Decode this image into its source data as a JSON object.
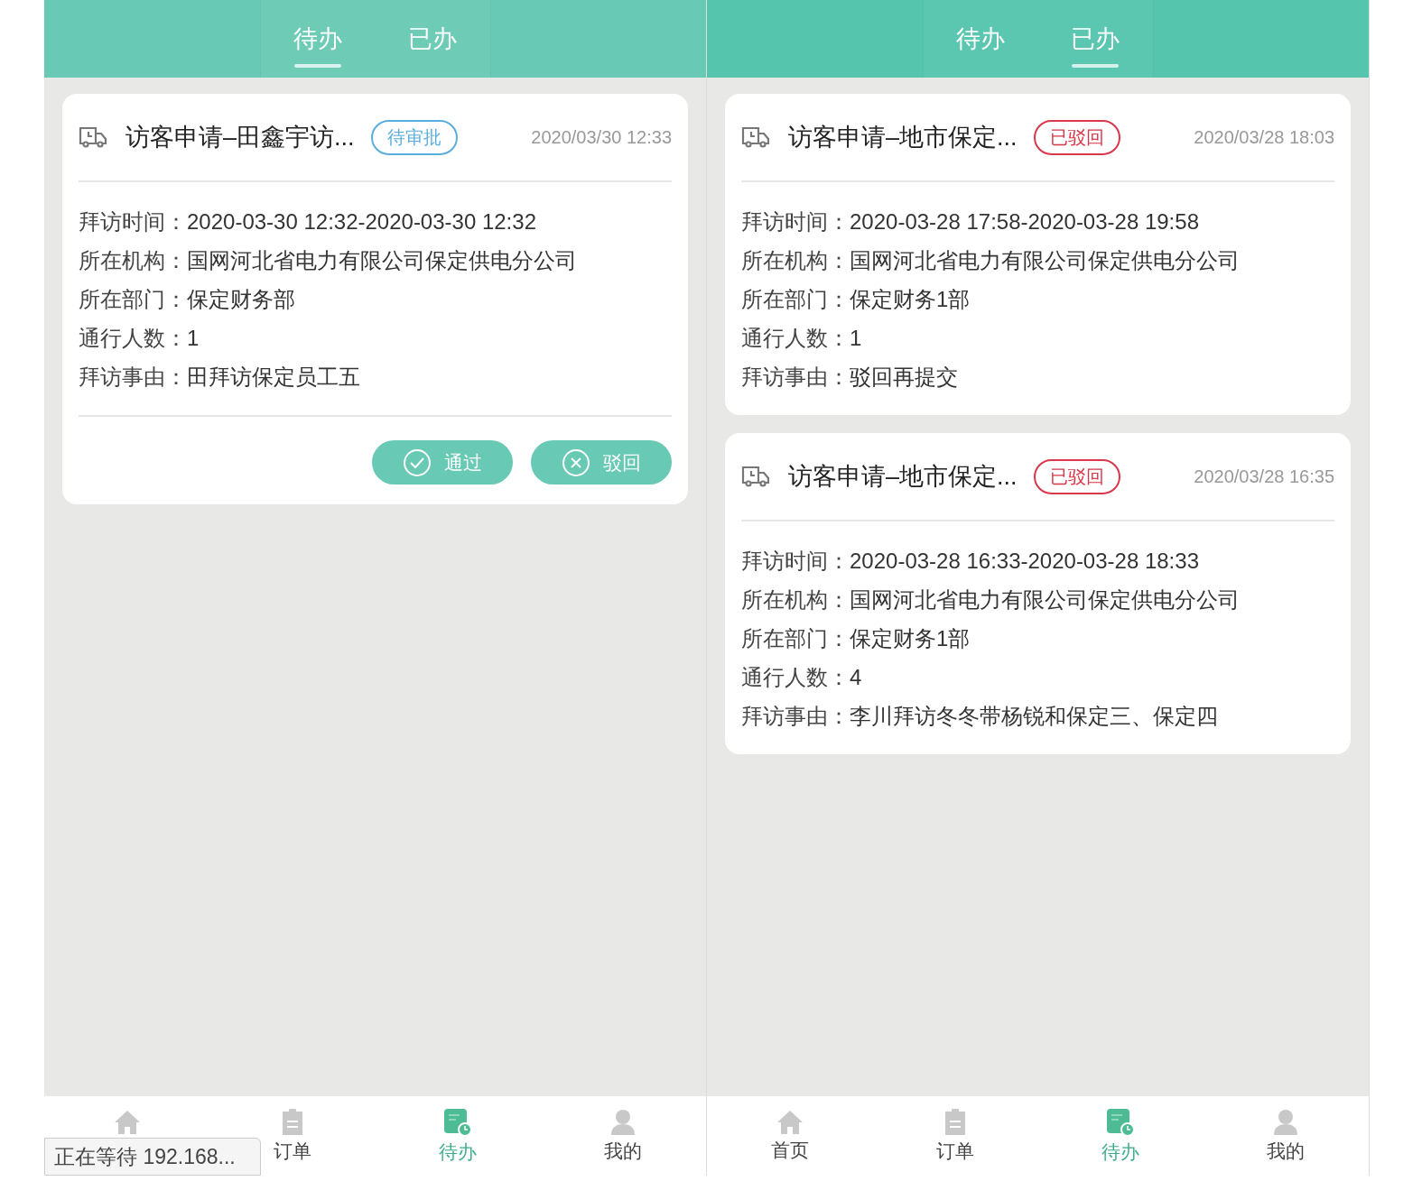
{
  "screens": [
    {
      "tabs": [
        {
          "label": "待办",
          "selected": true
        },
        {
          "label": "已办",
          "selected": false
        }
      ],
      "cards": [
        {
          "title": "访客申请–田鑫宇访...",
          "status": {
            "label": "待审批",
            "kind": "pending"
          },
          "time": "2020/03/30 12:33",
          "fields": [
            {
              "label": "拜访时间：",
              "value": "2020-03-30 12:32-2020-03-30 12:32"
            },
            {
              "label": "所在机构：",
              "value": "国网河北省电力有限公司保定供电分公司"
            },
            {
              "label": "所在部门：",
              "value": "保定财务部"
            },
            {
              "label": "通行人数：",
              "value": "1"
            },
            {
              "label": "拜访事由：",
              "value": "田拜访保定员工五"
            }
          ],
          "actions": [
            {
              "label": "通过",
              "kind": "approve"
            },
            {
              "label": "驳回",
              "kind": "reject"
            }
          ]
        }
      ],
      "nav": [
        {
          "kind": "home",
          "selected": false
        },
        {
          "kind": "orders",
          "label": "订单",
          "selected": false
        },
        {
          "kind": "todo",
          "label": "待办",
          "selected": true
        },
        {
          "kind": "mine",
          "label": "我的",
          "selected": false
        }
      ],
      "status_tooltip": "正在等待 192.168..."
    },
    {
      "tabs": [
        {
          "label": "待办",
          "selected": false
        },
        {
          "label": "已办",
          "selected": true
        }
      ],
      "cards": [
        {
          "title": "访客申请–地市保定...",
          "status": {
            "label": "已驳回",
            "kind": "rejected"
          },
          "time": "2020/03/28 18:03",
          "fields": [
            {
              "label": "拜访时间：",
              "value": "2020-03-28 17:58-2020-03-28 19:58"
            },
            {
              "label": "所在机构：",
              "value": "国网河北省电力有限公司保定供电分公司"
            },
            {
              "label": "所在部门：",
              "value": "保定财务1部"
            },
            {
              "label": "通行人数：",
              "value": "1"
            },
            {
              "label": "拜访事由：",
              "value": "驳回再提交"
            }
          ]
        },
        {
          "title": "访客申请–地市保定...",
          "status": {
            "label": "已驳回",
            "kind": "rejected"
          },
          "time": "2020/03/28 16:35",
          "fields": [
            {
              "label": "拜访时间：",
              "value": "2020-03-28 16:33-2020-03-28 18:33"
            },
            {
              "label": "所在机构：",
              "value": "国网河北省电力有限公司保定供电分公司"
            },
            {
              "label": "所在部门：",
              "value": "保定财务1部"
            },
            {
              "label": "通行人数：",
              "value": "4"
            },
            {
              "label": "拜访事由：",
              "value": "李川拜访冬冬带杨锐和保定三、保定四"
            }
          ]
        }
      ],
      "nav": [
        {
          "kind": "home",
          "label": "首页",
          "selected": false
        },
        {
          "kind": "orders",
          "label": "订单",
          "selected": false
        },
        {
          "kind": "todo",
          "label": "待办",
          "selected": true
        },
        {
          "kind": "mine",
          "label": "我的",
          "selected": false
        }
      ]
    }
  ]
}
